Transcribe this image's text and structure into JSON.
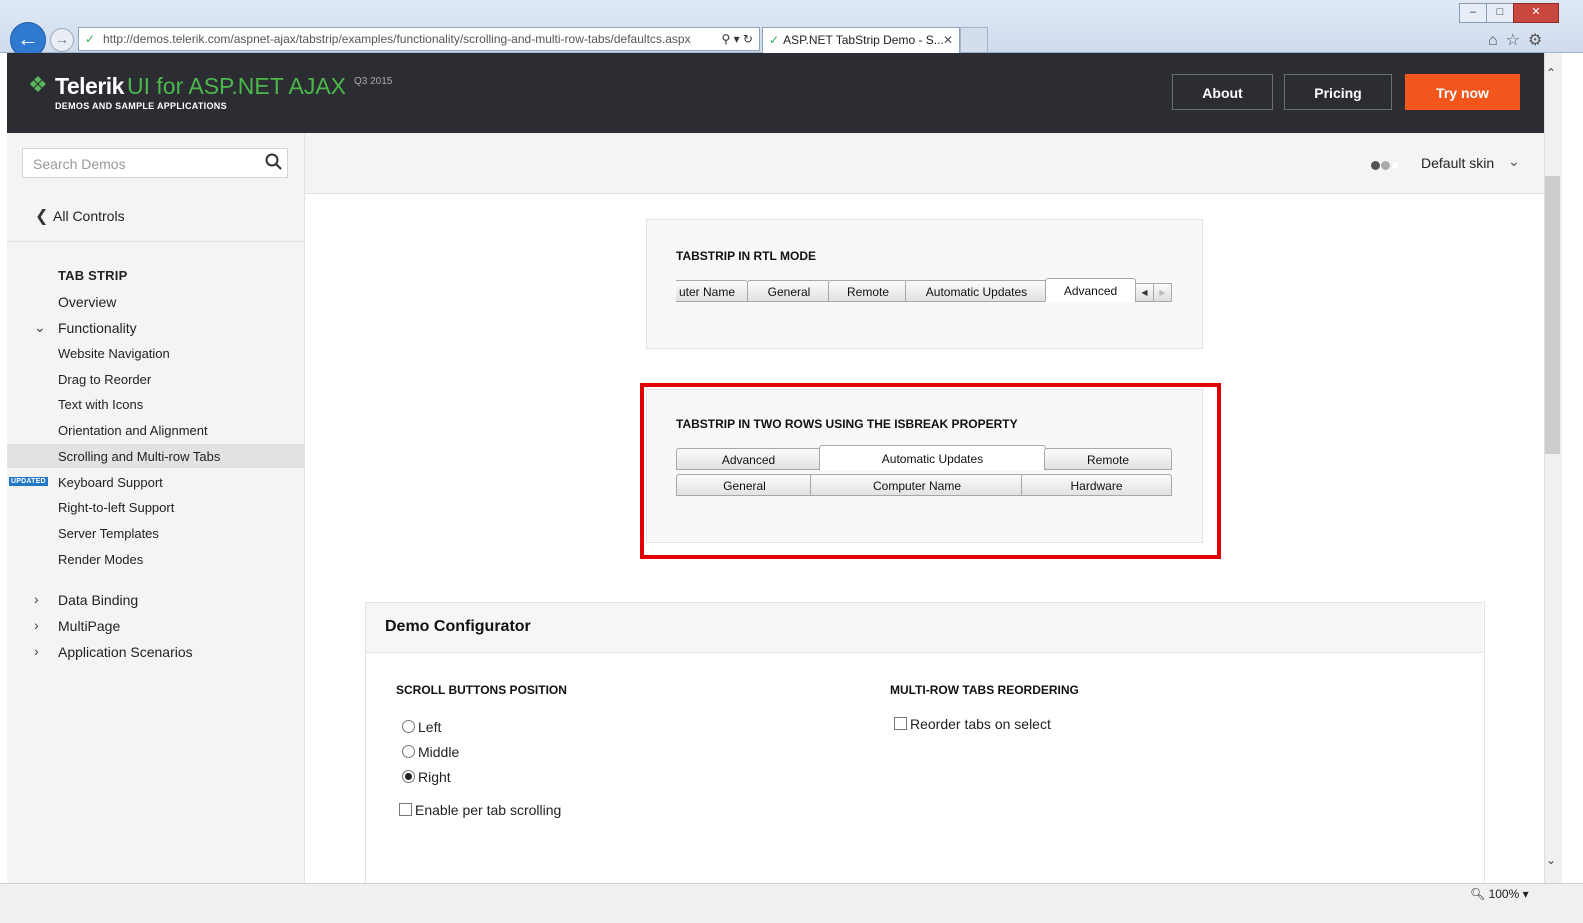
{
  "browser": {
    "url": "http://demos.telerik.com/aspnet-ajax/tabstrip/examples/functionality/scrolling-and-multi-row-tabs/defaultcs.aspx",
    "tab_title": "ASP.NET TabStrip Demo - S...",
    "zoom": "100%"
  },
  "header": {
    "brand": "Telerik",
    "product": "UI for ASP.NET AJAX",
    "version": "Q3 2015",
    "subtitle": "DEMOS AND SAMPLE APPLICATIONS",
    "about": "About",
    "pricing": "Pricing",
    "try": "Try now",
    "brand_color": "#4cb84b",
    "try_color": "#f2561d"
  },
  "sidebar": {
    "search_placeholder": "Search Demos",
    "all_controls": "All Controls",
    "section_title": "TAB STRIP",
    "items": [
      {
        "label": "Overview"
      },
      {
        "label": "Functionality"
      },
      {
        "label": "Website Navigation"
      },
      {
        "label": "Drag to Reorder"
      },
      {
        "label": "Text with Icons"
      },
      {
        "label": "Orientation and Alignment"
      },
      {
        "label": "Scrolling and Multi-row Tabs"
      },
      {
        "label": "Keyboard Support"
      },
      {
        "label": "Right-to-left Support"
      },
      {
        "label": "Server Templates"
      },
      {
        "label": "Render Modes"
      },
      {
        "label": "Data Binding"
      },
      {
        "label": "MultiPage"
      },
      {
        "label": "Application Scenarios"
      }
    ],
    "updated_badge": "UPDATED"
  },
  "skin": {
    "label": "Default skin"
  },
  "demo1": {
    "title": "TABSTRIP IN RTL MODE",
    "tabs": [
      "uter Name",
      "General",
      "Remote",
      "Automatic Updates",
      "Advanced"
    ]
  },
  "demo2": {
    "title": "TABSTRIP IN TWO ROWS USING THE ISBREAK PROPERTY",
    "row1": [
      "Advanced",
      "Automatic Updates",
      "Remote"
    ],
    "row2": [
      "General",
      "Computer Name",
      "Hardware"
    ]
  },
  "configurator": {
    "title": "Demo Configurator",
    "scroll_title": "SCROLL BUTTONS POSITION",
    "options": [
      "Left",
      "Middle",
      "Right"
    ],
    "per_tab": "Enable per tab scrolling",
    "multirow_title": "MULTI-ROW TABS REORDERING",
    "reorder": "Reorder tabs on select"
  }
}
